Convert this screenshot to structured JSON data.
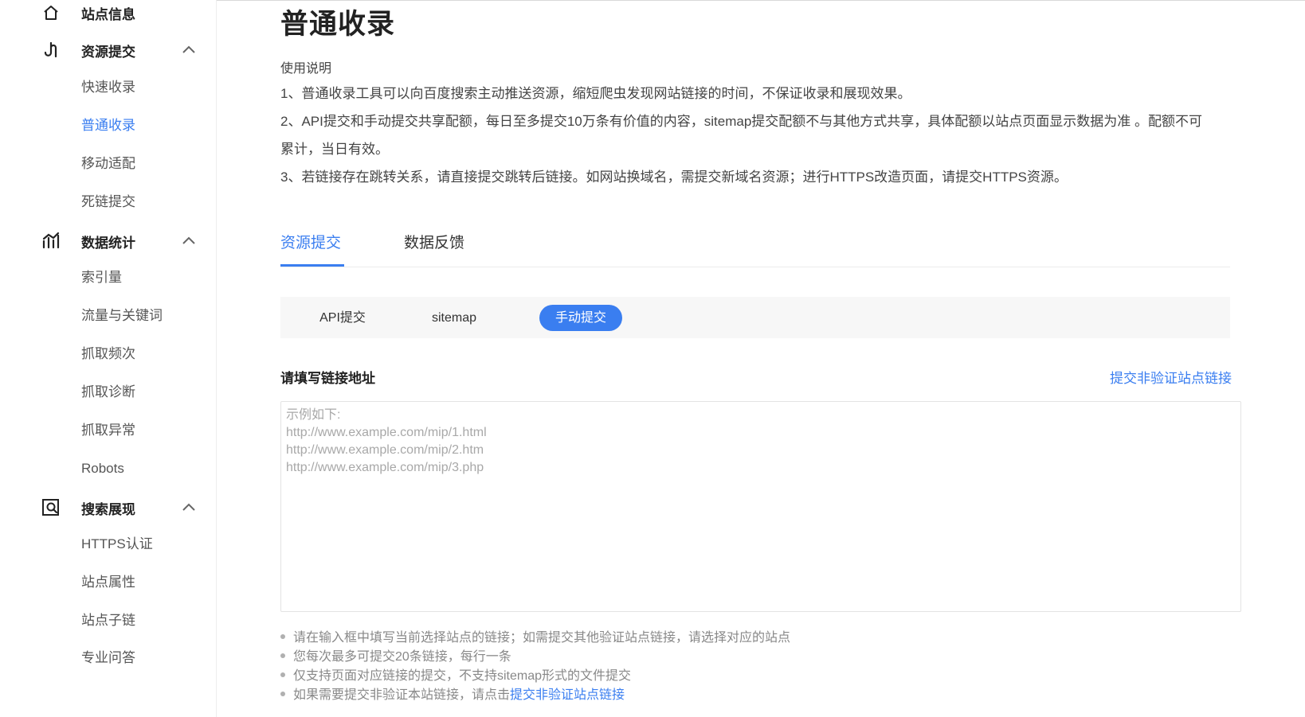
{
  "sidebar": {
    "groups": [
      {
        "label": "站点信息",
        "icon": "home-icon"
      },
      {
        "label": "资源提交",
        "icon": "submit-icon",
        "items": [
          "快速收录",
          "普通收录",
          "移动适配",
          "死链提交"
        ]
      },
      {
        "label": "数据统计",
        "icon": "stats-icon",
        "items": [
          "索引量",
          "流量与关键词",
          "抓取频次",
          "抓取诊断",
          "抓取异常",
          "Robots"
        ]
      },
      {
        "label": "搜索展现",
        "icon": "search-display-icon",
        "items": [
          "HTTPS认证",
          "站点属性",
          "站点子链",
          "专业问答"
        ]
      }
    ],
    "active_item": "普通收录"
  },
  "main": {
    "title": "普通收录",
    "usage_title": "使用说明",
    "usage_lines": [
      "1、普通收录工具可以向百度搜索主动推送资源，缩短爬虫发现网站链接的时间，不保证收录和展现效果。",
      "2、API提交和手动提交共享配额，每日至多提交10万条有价值的内容，sitemap提交配额不与其他方式共享，具体配额以站点页面显示数据为准 。配额不可",
      "累计，当日有效。",
      "3、若链接存在跳转关系，请直接提交跳转后链接。如网站换域名，需提交新域名资源；进行HTTPS改造页面，请提交HTTPS资源。"
    ],
    "tabs": [
      "资源提交",
      "数据反馈"
    ],
    "active_tab": "资源提交",
    "subtabs": [
      "API提交",
      "sitemap",
      "手动提交"
    ],
    "active_subtab": "手动提交",
    "field_label": "请填写链接地址",
    "field_link": "提交非验证站点链接",
    "textarea_placeholder": "示例如下:\nhttp://www.example.com/mip/1.html\nhttp://www.example.com/mip/2.htm\nhttp://www.example.com/mip/3.php",
    "notes": [
      "请在输入框中填写当前选择站点的链接；如需提交其他验证站点链接，请选择对应的站点",
      "您每次最多可提交20条链接，每行一条",
      "仅支持页面对应链接的提交，不支持sitemap形式的文件提交",
      "如果需要提交非验证本站链接，请点击"
    ],
    "note_link": "提交非验证站点链接"
  },
  "colors": {
    "accent": "#3a7ef0",
    "text": "#333333",
    "muted": "#888888"
  }
}
